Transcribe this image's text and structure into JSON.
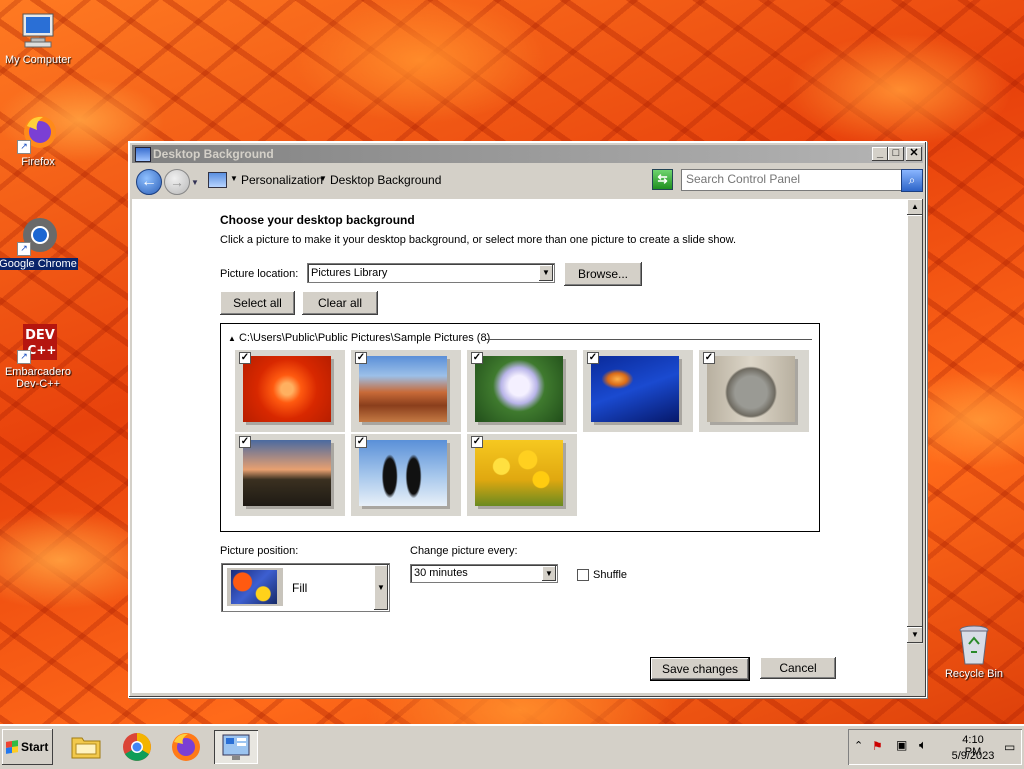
{
  "desktop": {
    "icons": [
      {
        "label": "My Computer"
      },
      {
        "label": "Firefox"
      },
      {
        "label": "Google Chrome"
      },
      {
        "label": "Embarcadero Dev-C++"
      },
      {
        "label": "Recycle Bin"
      }
    ]
  },
  "window": {
    "title": "Desktop Background",
    "controls": {
      "minimize": "_",
      "maximize": "□",
      "close": "✕"
    }
  },
  "address": {
    "crumbs": [
      "Personalization",
      "Desktop Background"
    ],
    "search_placeholder": "Search Control Panel"
  },
  "main": {
    "heading": "Choose your desktop background",
    "instructions": "Click a picture to make it your desktop background, or select more than one picture to create a slide show.",
    "picture_location_label": "Picture location:",
    "picture_location_value": "Pictures Library",
    "browse_label": "Browse...",
    "select_all_label": "Select all",
    "clear_all_label": "Clear all",
    "group_header": "C:\\Users\\Public\\Public Pictures\\Sample Pictures (8)",
    "thumbnails": [
      {
        "name": "Chrysanthemum",
        "checked": true
      },
      {
        "name": "Desert",
        "checked": true
      },
      {
        "name": "Hydrangeas",
        "checked": true
      },
      {
        "name": "Jellyfish",
        "checked": true
      },
      {
        "name": "Koala",
        "checked": true
      },
      {
        "name": "Lighthouse",
        "checked": true
      },
      {
        "name": "Penguins",
        "checked": true
      },
      {
        "name": "Tulips",
        "checked": true
      }
    ],
    "picture_position_label": "Picture position:",
    "picture_position_value": "Fill",
    "change_every_label": "Change picture every:",
    "change_every_value": "30 minutes",
    "shuffle_label": "Shuffle",
    "shuffle_checked": false,
    "save_label": "Save changes",
    "cancel_label": "Cancel"
  },
  "taskbar": {
    "start_label": "Start",
    "time": "4:10 PM",
    "date": "5/9/2023"
  }
}
